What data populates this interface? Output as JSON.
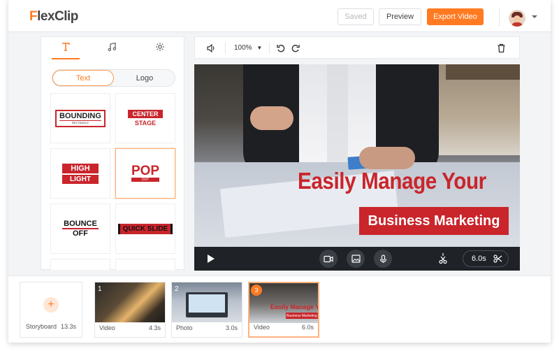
{
  "app": {
    "logo_prefix": "F",
    "logo_rest": "lexClip"
  },
  "header": {
    "saved_label": "Saved",
    "preview_label": "Preview",
    "export_label": "Export Video",
    "accent_color": "#ff7a21"
  },
  "left_panel": {
    "tabs": [
      {
        "name": "text",
        "icon": "text-T-icon"
      },
      {
        "name": "music",
        "icon": "music-note-icon"
      },
      {
        "name": "settings",
        "icon": "gear-icon"
      }
    ],
    "segments": {
      "text": "Text",
      "logo": "Logo"
    },
    "templates": [
      {
        "id": "bounding",
        "main": "BOUNDING",
        "sub": "RECTANGLE"
      },
      {
        "id": "center-stage",
        "main": "CENTER",
        "sub": "STAGE"
      },
      {
        "id": "high-light",
        "main": "HIGH",
        "sub": "LIGHT"
      },
      {
        "id": "pop-out",
        "main": "POP",
        "sub": "OUT"
      },
      {
        "id": "bounce-off",
        "main": "BOUNCE",
        "sub": "OFF"
      },
      {
        "id": "quick-slide",
        "main": "QUICK SLIDE",
        "sub": ""
      }
    ],
    "brand_red": "#c9252b"
  },
  "editor": {
    "zoom": "100%",
    "canvas_title": "Easily Manage Your",
    "canvas_subtitle": "Business Marketing",
    "duration": "6.0s"
  },
  "storyboard": {
    "label": "Storyboard",
    "total": "13.3s",
    "clips": [
      {
        "num": "1",
        "type": "Video",
        "duration": "4.3s"
      },
      {
        "num": "2",
        "type": "Photo",
        "duration": "3.0s"
      },
      {
        "num": "3",
        "type": "Video",
        "duration": "6.0s",
        "thumb_title": "Easily Manage Your",
        "thumb_sub": "Business Marketing"
      }
    ]
  }
}
